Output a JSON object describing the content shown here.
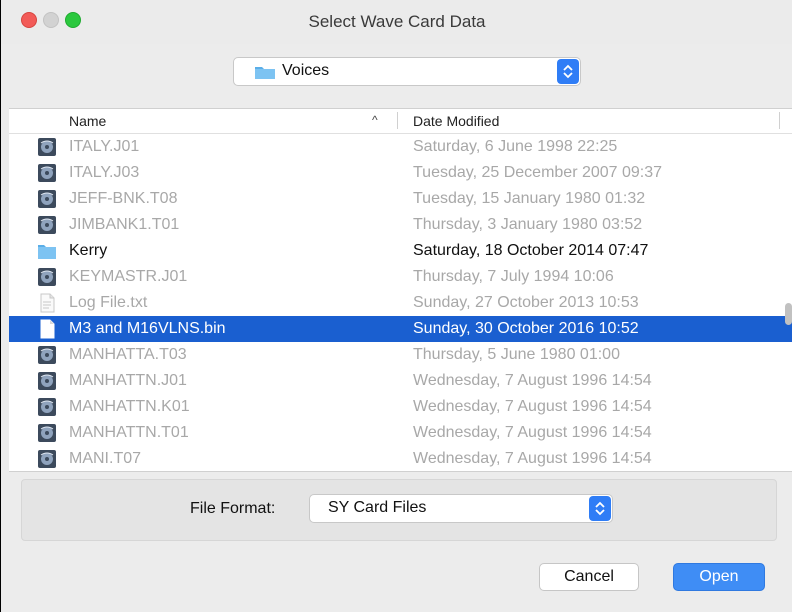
{
  "window": {
    "title": "Select Wave Card Data"
  },
  "location": {
    "value": "Voices",
    "icon": "folder-icon"
  },
  "columns": {
    "name": "Name",
    "sort_indicator": "^",
    "date": "Date Modified"
  },
  "files": [
    {
      "name": "ITALY.J01",
      "date": "Saturday, 6 June 1998 22:25",
      "icon": "disk-image-icon",
      "state": "dim"
    },
    {
      "name": "ITALY.J03",
      "date": "Tuesday, 25 December 2007 09:37",
      "icon": "disk-image-icon",
      "state": "dim"
    },
    {
      "name": "JEFF-BNK.T08",
      "date": "Tuesday, 15 January 1980 01:32",
      "icon": "disk-image-icon",
      "state": "dim"
    },
    {
      "name": "JIMBANK1.T01",
      "date": "Thursday, 3 January 1980 03:52",
      "icon": "disk-image-icon",
      "state": "dim"
    },
    {
      "name": "Kerry",
      "date": "Saturday, 18 October 2014 07:47",
      "icon": "folder-icon",
      "state": "normal"
    },
    {
      "name": "KEYMASTR.J01",
      "date": "Thursday, 7 July 1994 10:06",
      "icon": "disk-image-icon",
      "state": "dim"
    },
    {
      "name": "Log File.txt",
      "date": "Sunday, 27 October 2013 10:53",
      "icon": "text-document-icon",
      "state": "dim"
    },
    {
      "name": "M3 and M16VLNS.bin",
      "date": "Sunday, 30 October 2016 10:52",
      "icon": "document-icon",
      "state": "selected"
    },
    {
      "name": "MANHATTA.T03",
      "date": "Thursday, 5 June 1980 01:00",
      "icon": "disk-image-icon",
      "state": "dim"
    },
    {
      "name": "MANHATTN.J01",
      "date": "Wednesday, 7 August 1996 14:54",
      "icon": "disk-image-icon",
      "state": "dim"
    },
    {
      "name": "MANHATTN.K01",
      "date": "Wednesday, 7 August 1996 14:54",
      "icon": "disk-image-icon",
      "state": "dim"
    },
    {
      "name": "MANHATTN.T01",
      "date": "Wednesday, 7 August 1996 14:54",
      "icon": "disk-image-icon",
      "state": "dim"
    },
    {
      "name": "MANI.T07",
      "date": "Wednesday, 7 August 1996 14:54",
      "icon": "disk-image-icon",
      "state": "dim"
    }
  ],
  "format": {
    "label": "File Format:",
    "value": "SY Card Files"
  },
  "buttons": {
    "cancel": "Cancel",
    "open": "Open"
  },
  "colors": {
    "accent": "#3f8df5",
    "selection": "#1a5fd0",
    "close": "#f25b58",
    "zoom": "#2bc83e"
  }
}
